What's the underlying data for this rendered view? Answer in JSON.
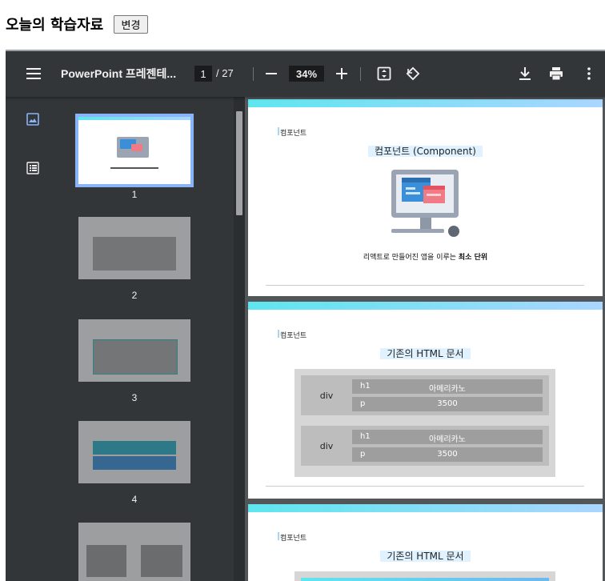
{
  "header": {
    "title": "오늘의 학습자료",
    "change_button": "변경"
  },
  "toolbar": {
    "menu_icon": "menu-icon",
    "doc_title": "PowerPoint 프레젠테...",
    "current_page": "1",
    "total_pages": "/ 27",
    "zoom": "34%",
    "icons": [
      "zoom-out-icon",
      "zoom-in-icon",
      "fit-page-icon",
      "rotate-icon",
      "download-icon",
      "print-icon",
      "more-vert-icon"
    ]
  },
  "sidebar": {
    "tabs": [
      "thumbnail-icon",
      "outline-icon"
    ],
    "thumbnails": [
      "1",
      "2",
      "3",
      "4",
      ""
    ]
  },
  "slides": [
    {
      "crumb": "컴포넌트",
      "heading": "컴포넌트 (Component)",
      "subtitle_prefix": "리액트로 만들어진 앱을 이루는 ",
      "subtitle_bold": "최소 단위"
    },
    {
      "crumb": "컴포넌트",
      "heading": "기존의 HTML 문서",
      "rows": [
        {
          "label": "div",
          "cells": [
            {
              "k": "h1",
              "v": "아메리카노"
            },
            {
              "k": "p",
              "v": "3500"
            }
          ]
        },
        {
          "label": "div",
          "cells": [
            {
              "k": "h1",
              "v": "아메리카노"
            },
            {
              "k": "p",
              "v": "3500"
            }
          ]
        }
      ]
    },
    {
      "crumb": "컴포넌트",
      "heading": "기존의 HTML 문서"
    }
  ],
  "colors": {
    "toolbar": "#323639",
    "viewer_bg": "#525659",
    "accent": "#8ab4f8"
  }
}
